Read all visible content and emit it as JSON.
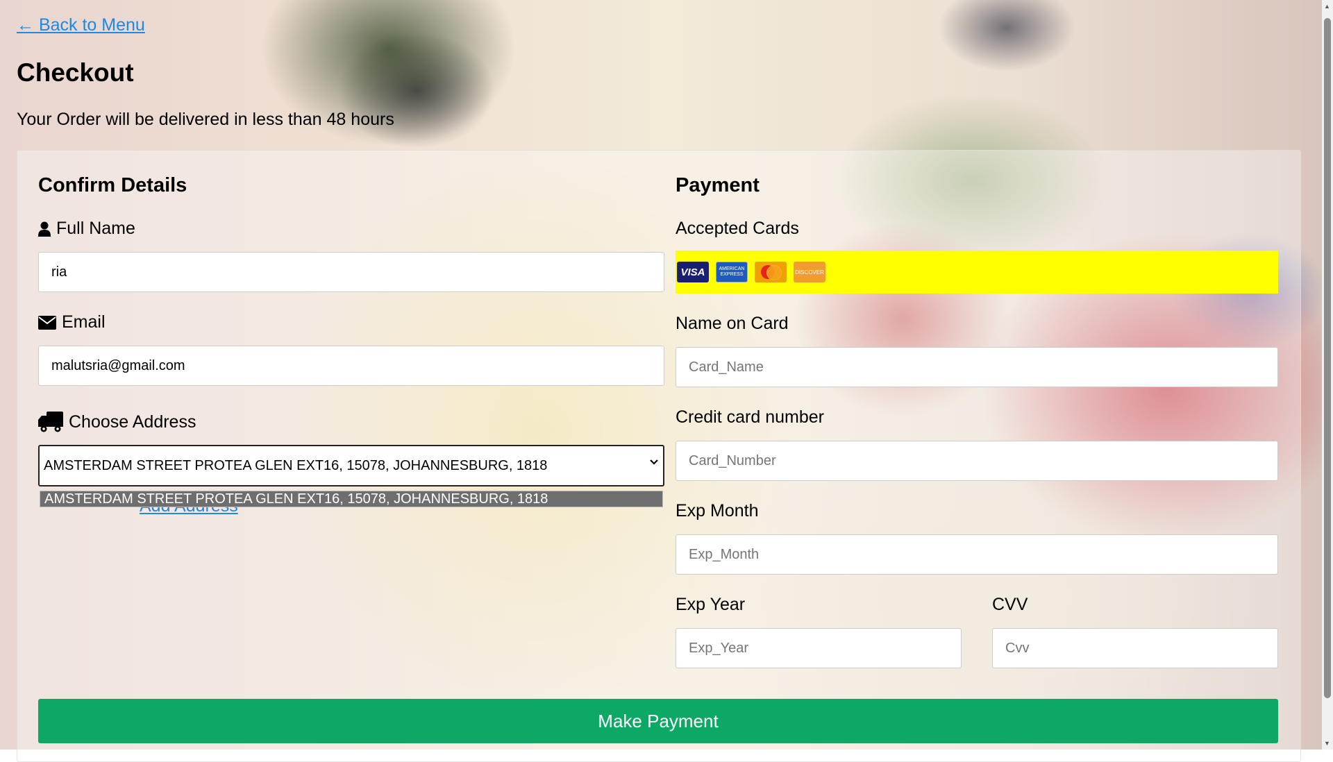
{
  "nav": {
    "back_label": "← Back to Menu"
  },
  "page": {
    "title": "Checkout",
    "subtitle": "Your Order will be delivered in less than 48 hours"
  },
  "details": {
    "title": "Confirm Details",
    "full_name": {
      "label": "Full Name",
      "icon": "user-icon",
      "value": "ria"
    },
    "email": {
      "label": "Email",
      "icon": "envelope-icon",
      "value": "malutsria@gmail.com"
    },
    "address": {
      "label": "Choose Address",
      "icon": "truck-icon",
      "selected": "AMSTERDAM STREET PROTEA GLEN EXT16, 15078, JOHANNESBURG, 1818",
      "options": [
        "AMSTERDAM STREET PROTEA GLEN EXT16, 15078, JOHANNESBURG, 1818"
      ],
      "add_label": "Add Address"
    }
  },
  "payment": {
    "title": "Payment",
    "accepted_label": "Accepted Cards",
    "cards": [
      "VISA",
      "AMERICAN EXPRESS",
      "mastercard",
      "DISCOVER"
    ],
    "cards_bar_color": "#ffff00",
    "name_on_card": {
      "label": "Name on Card",
      "placeholder": "Card_Name"
    },
    "card_number": {
      "label": "Credit card number",
      "placeholder": "Card_Number"
    },
    "exp_month": {
      "label": "Exp Month",
      "placeholder": "Exp_Month"
    },
    "exp_year": {
      "label": "Exp Year",
      "placeholder": "Exp_Year"
    },
    "cvv": {
      "label": "CVV",
      "placeholder": "Cvv"
    }
  },
  "submit": {
    "label": "Make Payment",
    "color": "#0ea866"
  }
}
